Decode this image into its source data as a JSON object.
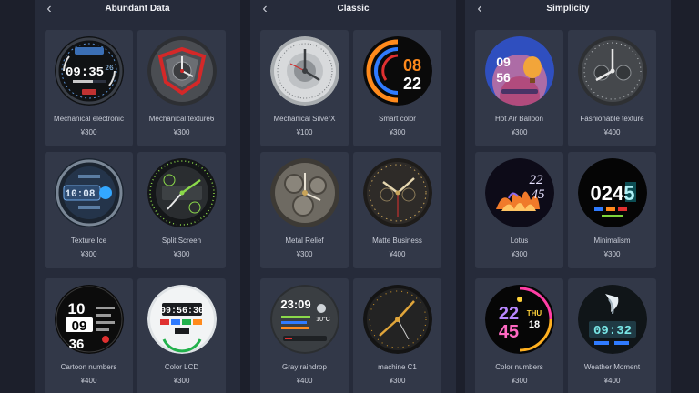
{
  "panels": [
    {
      "title": "Abundant Data",
      "items": [
        {
          "name": "Mechanical electronic",
          "price": "¥300",
          "time": "09:35",
          "sec": "26",
          "icon": "mechanical-electronic-watch-face-icon"
        },
        {
          "name": "Mechanical texture6",
          "price": "¥300",
          "icon": "mechanical-texture-watch-face-icon"
        },
        {
          "name": "Texture Ice",
          "price": "¥300",
          "time": "10:08",
          "icon": "texture-ice-watch-face-icon"
        },
        {
          "name": "Split Screen",
          "price": "¥300",
          "icon": "split-screen-watch-face-icon"
        },
        {
          "name": "Cartoon numbers",
          "price": "¥400",
          "hour": "10",
          "min": "09",
          "sec": "36",
          "icon": "cartoon-numbers-watch-face-icon"
        },
        {
          "name": "Color LCD",
          "price": "¥300",
          "time": "09:56:30",
          "icon": "color-lcd-watch-face-icon"
        }
      ]
    },
    {
      "title": "Classic",
      "items": [
        {
          "name": "Mechanical SilverX",
          "price": "¥100",
          "icon": "mechanical-silverx-watch-face-icon"
        },
        {
          "name": "Smart color",
          "price": "¥300",
          "hour": "08",
          "min": "22",
          "icon": "smart-color-watch-face-icon"
        },
        {
          "name": "Metal Relief",
          "price": "¥300",
          "icon": "metal-relief-watch-face-icon"
        },
        {
          "name": "Matte Business",
          "price": "¥400",
          "icon": "matte-business-watch-face-icon"
        },
        {
          "name": "Gray raindrop",
          "price": "¥400",
          "time": "23:09",
          "temp": "10°C",
          "icon": "gray-raindrop-watch-face-icon"
        },
        {
          "name": "machine C1",
          "price": "¥300",
          "icon": "machine-c1-watch-face-icon"
        }
      ]
    },
    {
      "title": "Simplicity",
      "items": [
        {
          "name": "Hot Air Balloon",
          "price": "¥300",
          "hour": "09",
          "min": "56",
          "icon": "hot-air-balloon-watch-face-icon"
        },
        {
          "name": "Fashionable texture",
          "price": "¥400",
          "icon": "fashionable-texture-watch-face-icon"
        },
        {
          "name": "Lotus",
          "price": "¥300",
          "hour": "22",
          "min": "45",
          "icon": "lotus-watch-face-icon"
        },
        {
          "name": "Minimalism",
          "price": "¥300",
          "time": "0245",
          "icon": "minimalism-watch-face-icon"
        },
        {
          "name": "Color numbers",
          "price": "¥300",
          "hour": "22",
          "min": "45",
          "day": "THU",
          "date": "18",
          "icon": "color-numbers-watch-face-icon"
        },
        {
          "name": "Weather Moment",
          "price": "¥400",
          "time": "09:32",
          "icon": "weather-moment-watch-face-icon"
        }
      ]
    }
  ],
  "colors": {
    "background": "#1c1f2b",
    "panel": "#262b3a",
    "card": "#323848",
    "accent_orange": "#ff8a1c",
    "accent_blue": "#2f7bff",
    "accent_red": "#e03030",
    "accent_green": "#7fd53b"
  }
}
